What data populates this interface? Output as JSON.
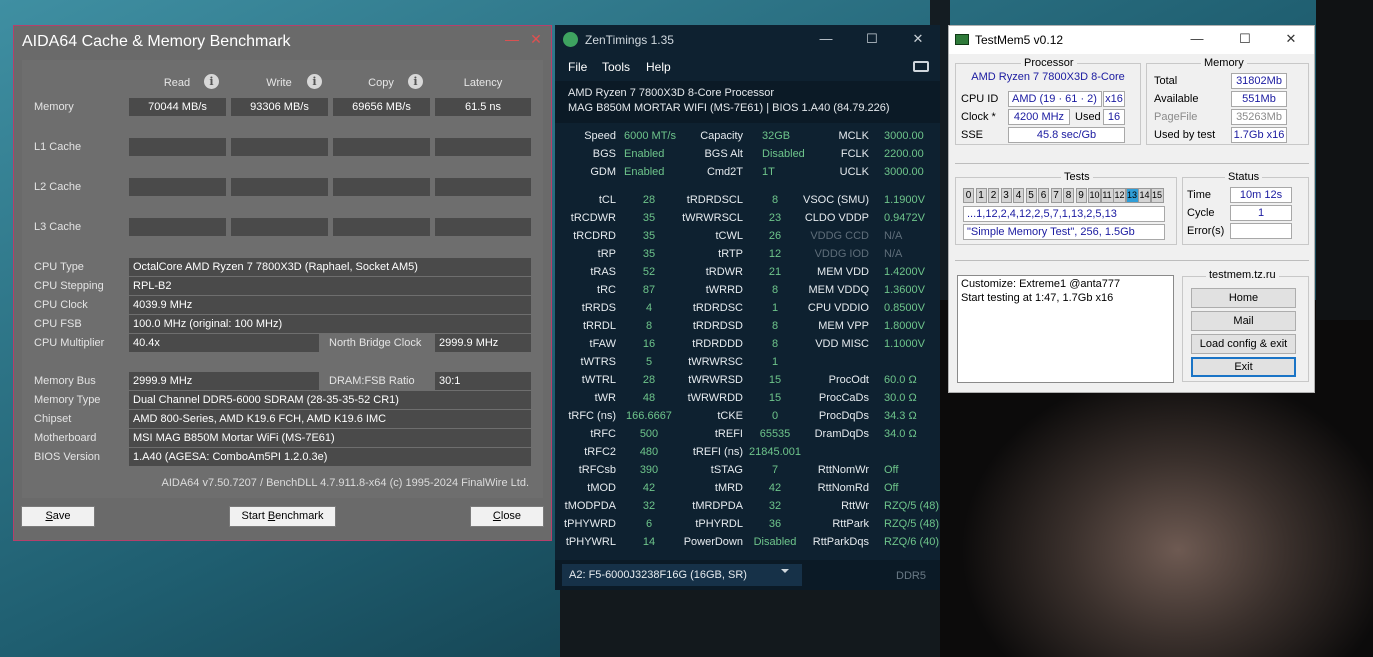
{
  "aida": {
    "title": "AIDA64 Cache & Memory Benchmark",
    "minimize_glyph": "—",
    "close_glyph": "✕",
    "columns": {
      "read": "Read",
      "write": "Write",
      "copy": "Copy",
      "latency": "Latency"
    },
    "info_glyph": "i",
    "rows": {
      "memory": {
        "label": "Memory",
        "read": "70044 MB/s",
        "write": "93306 MB/s",
        "copy": "69656 MB/s",
        "latency": "61.5 ns"
      },
      "l1": {
        "label": "L1 Cache"
      },
      "l2": {
        "label": "L2 Cache"
      },
      "l3": {
        "label": "L3 Cache"
      }
    },
    "info": {
      "cpu_type_label": "CPU Type",
      "cpu_type": "OctalCore AMD Ryzen 7 7800X3D  (Raphael, Socket AM5)",
      "cpu_stepping_label": "CPU Stepping",
      "cpu_stepping": "RPL-B2",
      "cpu_clock_label": "CPU Clock",
      "cpu_clock": "4039.9 MHz",
      "cpu_fsb_label": "CPU FSB",
      "cpu_fsb": "100.0 MHz  (original: 100 MHz)",
      "cpu_multiplier_label": "CPU Multiplier",
      "cpu_multiplier": "40.4x",
      "nb_clock_label": "North Bridge Clock",
      "nb_clock": "2999.9 MHz",
      "memory_bus_label": "Memory Bus",
      "memory_bus": "2999.9 MHz",
      "dram_fsb_label": "DRAM:FSB Ratio",
      "dram_fsb": "30:1",
      "memory_type_label": "Memory Type",
      "memory_type": "Dual Channel DDR5-6000 SDRAM  (28-35-35-52 CR1)",
      "chipset_label": "Chipset",
      "chipset": "AMD 800-Series, AMD K19.6 FCH, AMD K19.6 IMC",
      "motherboard_label": "Motherboard",
      "motherboard": "MSI MAG B850M Mortar WiFi (MS-7E61)",
      "bios_label": "BIOS Version",
      "bios": "1.A40  (AGESA: ComboAm5PI 1.2.0.3e)"
    },
    "footer": "AIDA64 v7.50.7207 / BenchDLL 4.7.911.8-x64  (c) 1995-2024 FinalWire Ltd.",
    "buttons": {
      "save_first": "S",
      "save_rest": "ave",
      "start": "Start ",
      "start_u": "B",
      "start_rest": "enchmark",
      "close_first": "C",
      "close_rest": "lose"
    }
  },
  "zen": {
    "title": "ZenTimings 1.35",
    "menu": {
      "file": "File",
      "tools": "Tools",
      "help": "Help"
    },
    "proc_line1": "AMD Ryzen 7 7800X3D 8-Core Processor",
    "proc_line2": "MAG B850M MORTAR WIFI (MS-7E61) | BIOS 1.A40 (84.79.226)",
    "top": [
      {
        "k1": "Speed",
        "v1": "6000 MT/s",
        "k2": "Capacity",
        "v2": "32GB",
        "k3": "MCLK",
        "v3": "3000.00"
      },
      {
        "k1": "BGS",
        "v1": "Enabled",
        "k2": "BGS Alt",
        "v2": "Disabled",
        "k3": "FCLK",
        "v3": "2200.00"
      },
      {
        "k1": "GDM",
        "v1": "Enabled",
        "k2": "Cmd2T",
        "v2": "1T",
        "k3": "UCLK",
        "v3": "3000.00"
      }
    ],
    "rows": [
      {
        "k1": "tCL",
        "v1": "28",
        "k2": "tRDRDSCL",
        "v2": "8",
        "k3": "VSOC (SMU)",
        "v3": "1.1900V"
      },
      {
        "k1": "tRCDWR",
        "v1": "35",
        "k2": "tWRWRSCL",
        "v2": "23",
        "k3": "CLDO VDDP",
        "v3": "0.9472V"
      },
      {
        "k1": "tRCDRD",
        "v1": "35",
        "k2": "tCWL",
        "v2": "26",
        "k3": "VDDG CCD",
        "v3": "N/A",
        "dim": true
      },
      {
        "k1": "tRP",
        "v1": "35",
        "k2": "tRTP",
        "v2": "12",
        "k3": "VDDG IOD",
        "v3": "N/A",
        "dim": true
      },
      {
        "k1": "tRAS",
        "v1": "52",
        "k2": "tRDWR",
        "v2": "21",
        "k3": "MEM VDD",
        "v3": "1.4200V"
      },
      {
        "k1": "tRC",
        "v1": "87",
        "k2": "tWRRD",
        "v2": "8",
        "k3": "MEM VDDQ",
        "v3": "1.3600V"
      },
      {
        "k1": "tRRDS",
        "v1": "4",
        "k2": "tRDRDSC",
        "v2": "1",
        "k3": "CPU VDDIO",
        "v3": "0.8500V"
      },
      {
        "k1": "tRRDL",
        "v1": "8",
        "k2": "tRDRDSD",
        "v2": "8",
        "k3": "MEM VPP",
        "v3": "1.8000V"
      },
      {
        "k1": "tFAW",
        "v1": "16",
        "k2": "tRDRDDD",
        "v2": "8",
        "k3": "VDD MISC",
        "v3": "1.1000V"
      },
      {
        "k1": "tWTRS",
        "v1": "5",
        "k2": "tWRWRSC",
        "v2": "1",
        "k3": "",
        "v3": ""
      },
      {
        "k1": "tWTRL",
        "v1": "28",
        "k2": "tWRWRSD",
        "v2": "15",
        "k3": "ProcOdt",
        "v3": "60.0 Ω"
      },
      {
        "k1": "tWR",
        "v1": "48",
        "k2": "tWRWRDD",
        "v2": "15",
        "k3": "ProcCaDs",
        "v3": "30.0 Ω"
      },
      {
        "k1": "tRFC (ns)",
        "v1": "166.6667",
        "k2": "tCKE",
        "v2": "0",
        "k3": "ProcDqDs",
        "v3": "34.3 Ω"
      },
      {
        "k1": "tRFC",
        "v1": "500",
        "k2": "tREFI",
        "v2": "65535",
        "k3": "DramDqDs",
        "v3": "34.0 Ω"
      },
      {
        "k1": "tRFC2",
        "v1": "480",
        "k2": "tREFI (ns)",
        "v2": "21845.001",
        "k3": "",
        "v3": ""
      },
      {
        "k1": "tRFCsb",
        "v1": "390",
        "k2": "tSTAG",
        "v2": "7",
        "k3": "RttNomWr",
        "v3": "Off"
      },
      {
        "k1": "tMOD",
        "v1": "42",
        "k2": "tMRD",
        "v2": "42",
        "k3": "RttNomRd",
        "v3": "Off"
      },
      {
        "k1": "tMODPDA",
        "v1": "32",
        "k2": "tMRDPDA",
        "v2": "32",
        "k3": "RttWr",
        "v3": "RZQ/5 (48)"
      },
      {
        "k1": "tPHYWRD",
        "v1": "6",
        "k2": "tPHYRDL",
        "v2": "36",
        "k3": "RttPark",
        "v3": "RZQ/5 (48)"
      },
      {
        "k1": "tPHYWRL",
        "v1": "14",
        "k2": "PowerDown",
        "v2": "Disabled",
        "k3": "RttParkDqs",
        "v3": "RZQ/6 (40)"
      }
    ],
    "dimm": "A2: F5-6000J3238F16G (16GB, SR)",
    "ddr": "DDR5"
  },
  "tm": {
    "title": "TestMem5 v0.12",
    "processor": {
      "title": "Processor",
      "name": "AMD Ryzen 7 7800X3D 8-Core",
      "cpuid_label": "CPU ID",
      "cpuid": "AMD  (19 · 61 · 2)",
      "cpuid_threads": "x16",
      "clock_label": "Clock *",
      "clock": "4200 MHz",
      "used_label": "Used",
      "used": "16",
      "sse_label": "SSE",
      "sse": "45.8 sec/Gb"
    },
    "memory": {
      "title": "Memory",
      "total_label": "Total",
      "total": "31802Mb",
      "available_label": "Available",
      "available": "551Mb",
      "pagefile_label": "PageFile",
      "pagefile": "35263Mb",
      "usedby_label": "Used by test",
      "usedby": "1.7Gb x16"
    },
    "tests": {
      "title": "Tests",
      "cells": [
        "0",
        "1",
        "2",
        "3",
        "4",
        "5",
        "6",
        "7",
        "8",
        "9",
        "10",
        "11",
        "12",
        "13",
        "14",
        "15"
      ],
      "active": 13,
      "sequence": "...1,12,2,4,12,2,5,7,1,13,2,5,13",
      "config": "\"Simple Memory Test\", 256, 1.5Gb"
    },
    "status": {
      "title": "Status",
      "time_label": "Time",
      "time": "10m 12s",
      "cycle_label": "Cycle",
      "cycle": "1",
      "errors_label": "Error(s)",
      "errors": ""
    },
    "log_line1": "Customize: Extreme1 @anta777",
    "log_line2": "Start testing at 1:47, 1.7Gb x16",
    "site": "testmem.tz.ru",
    "buttons": {
      "home": "Home",
      "mail": "Mail",
      "load": "Load config & exit",
      "exit": "Exit"
    }
  },
  "colors": {
    "aida_accent": "#b5406b",
    "zen_value": "#6ec58b",
    "tm_value": "#1a1aa0",
    "tm_active_cell": "#2f9ed8"
  }
}
